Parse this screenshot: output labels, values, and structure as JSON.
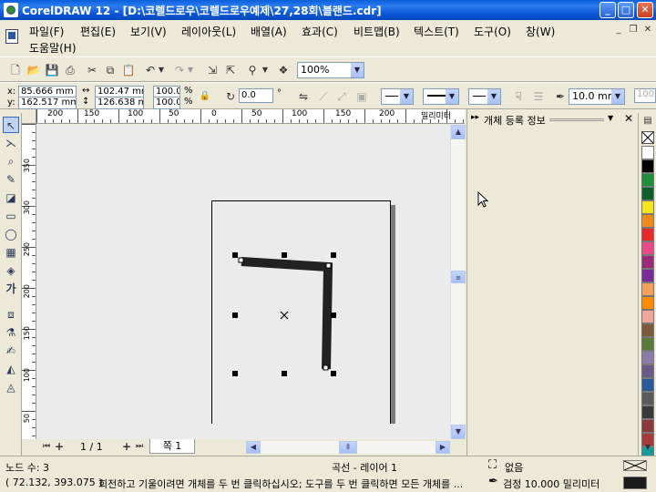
{
  "window": {
    "title": "CorelDRAW 12 - [D:\\코렐드로우\\코렐드로우예제\\27,28회\\블랜드.cdr]"
  },
  "menu": {
    "items": [
      "파일(F)",
      "편집(E)",
      "보기(V)",
      "레이아웃(L)",
      "배열(A)",
      "효과(C)",
      "비트맵(B)",
      "텍스트(T)",
      "도구(O)",
      "창(W)",
      "도움말(H)"
    ]
  },
  "standard_toolbar": {
    "zoom_level": "100%"
  },
  "property_bar": {
    "x_label": "x:",
    "y_label": "y:",
    "x_value": "85.666 mm",
    "y_value": "162.517 mm",
    "width_value": "102.47 mm",
    "height_value": "126.638 mr",
    "scale_x": "100.0",
    "scale_y": "100.0",
    "percent": "%",
    "rotation": "0.0",
    "degree": "°",
    "outline_width": "10.0 mm",
    "extra": "100"
  },
  "rulers": {
    "unit": "밀리미터",
    "h_ticks": [
      "200",
      "150",
      "100",
      "50",
      "0",
      "50",
      "100",
      "150",
      "200"
    ],
    "v_ticks": [
      "350",
      "300",
      "250",
      "200",
      "150",
      "100",
      "50"
    ]
  },
  "page_nav": {
    "page_counter": "1 / 1",
    "page_tab": "쪽 1"
  },
  "docker": {
    "title": "개체 등록 정보"
  },
  "palette": {
    "colors": [
      "#ffffff",
      "#000000",
      "#1f8f3a",
      "#0f5f2a",
      "#f7e41c",
      "#f08b1a",
      "#e82a2a",
      "#e84a8a",
      "#9c2a7a",
      "#7a2a9a",
      "#f5a05a",
      "#ff8c00",
      "#f4a59a",
      "#7a5a3a",
      "#5a7a3a",
      "#8a7aa8",
      "#6a5a8a",
      "#2a5a9a",
      "#5a5a5a",
      "#3a3a3a",
      "#8a3a3a",
      "#a83a3a",
      "#1a9a9a",
      "#2a2a2a"
    ]
  },
  "status": {
    "node_count": "노드 수: 3",
    "object_info": "곡선 - 레이어 1",
    "fill_label": "없음",
    "coordinates": "( 72.132, 393.075 )",
    "hint": "회전하고 기울이려면 개체를 두 번 클릭하십시오; 도구를 두 번 클릭하면 모든 개체를 ...",
    "outline_label": "검정  10.000 밀리미터",
    "fill_color": "#ffffff",
    "outline_color": "#1a1a1a"
  }
}
